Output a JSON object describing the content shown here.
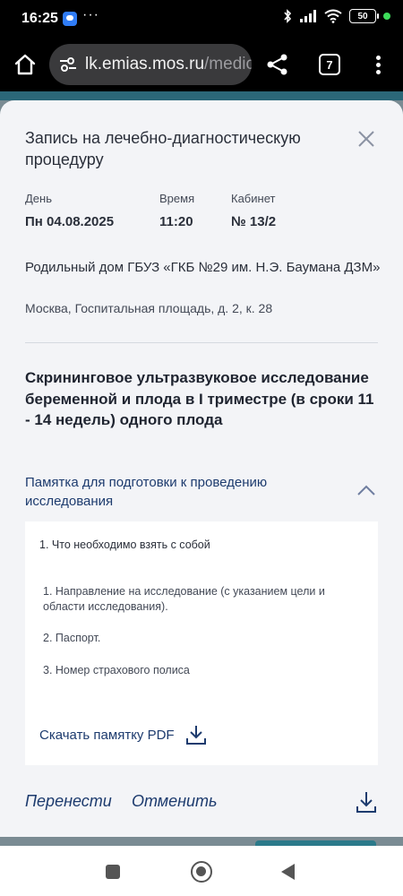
{
  "status_bar": {
    "time": "16:25",
    "more": "···",
    "battery": "50",
    "icons": [
      "chat-notification-icon",
      "bluetooth-icon",
      "signal-icon",
      "wifi-icon",
      "battery-icon"
    ]
  },
  "browser": {
    "url_host": "lk.emias.mos.ru",
    "url_path": "/medic",
    "tab_count": "7",
    "icons": [
      "home-icon",
      "site-settings-icon",
      "share-icon",
      "tabs-icon",
      "menu-icon"
    ]
  },
  "modal": {
    "title": "Запись на лечебно-диагностическую процедуру",
    "meta": [
      {
        "label": "День",
        "value": "Пн 04.08.2025"
      },
      {
        "label": "Время",
        "value": "11:20"
      },
      {
        "label": "Кабинет",
        "value": "№ 13/2"
      }
    ],
    "clinic_name": "Родильный дом ГБУЗ «ГКБ №29 им. Н.Э. Баумана ДЗМ»",
    "clinic_address": "Москва, Госпитальная площадь, д. 2, к. 28",
    "procedure": "Скрининговое ультразвуковое исследование беременной и плода в I триместре (в сроки 11 - 14 недель) одного плода",
    "memo": {
      "title": "Памятка для подготовки к проведению исследования",
      "section_title": "1. Что необходимо взять с собой",
      "items": [
        "1. Направление на исследование (с указанием цели и области исследования).",
        "2. Паспорт.",
        "3. Номер страхового полиса"
      ],
      "download_label": "Скачать памятку PDF"
    },
    "actions": {
      "reschedule": "Перенести",
      "cancel": "Отменить"
    }
  }
}
